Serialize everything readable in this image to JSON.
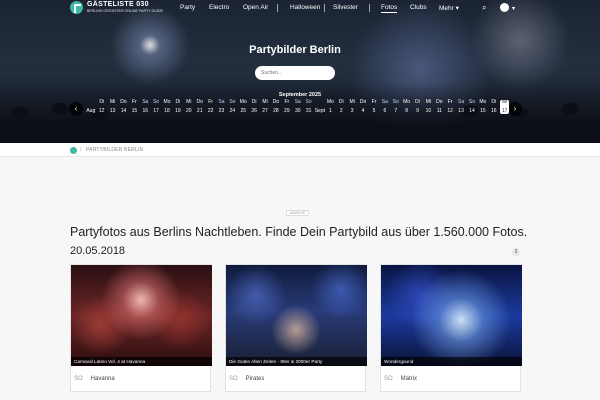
{
  "header": {
    "logo_title": "GÄSTELISTE 030",
    "logo_sub": "BERLINS GRÖSSTER ONLINE PARTY GUIDE",
    "nav": [
      "Party",
      "Electro",
      "Open Air",
      "Halloween",
      "Silvester",
      "Fotos",
      "Clubs",
      "Mehr"
    ],
    "active_nav": "Fotos"
  },
  "hero": {
    "title": "Partybilder Berlin",
    "search_placeholder": "Suchen..."
  },
  "calendar": {
    "month": "September 2025",
    "days": [
      {
        "w": "",
        "d": "Aug"
      },
      {
        "w": "Di",
        "d": "12"
      },
      {
        "w": "Mi",
        "d": "13"
      },
      {
        "w": "Do",
        "d": "14"
      },
      {
        "w": "Fr",
        "d": "15"
      },
      {
        "w": "Sa",
        "d": "16"
      },
      {
        "w": "So",
        "d": "17"
      },
      {
        "w": "Mo",
        "d": "18"
      },
      {
        "w": "Di",
        "d": "19"
      },
      {
        "w": "Mi",
        "d": "20"
      },
      {
        "w": "Do",
        "d": "21"
      },
      {
        "w": "Fr",
        "d": "22"
      },
      {
        "w": "Sa",
        "d": "23"
      },
      {
        "w": "So",
        "d": "24"
      },
      {
        "w": "Mo",
        "d": "25"
      },
      {
        "w": "Di",
        "d": "26"
      },
      {
        "w": "Mi",
        "d": "27"
      },
      {
        "w": "Do",
        "d": "28"
      },
      {
        "w": "Fr",
        "d": "29"
      },
      {
        "w": "Sa",
        "d": "30"
      },
      {
        "w": "So",
        "d": "31"
      },
      {
        "w": "",
        "d": "Sept"
      },
      {
        "w": "Mo",
        "d": "1"
      },
      {
        "w": "Di",
        "d": "2"
      },
      {
        "w": "Mi",
        "d": "3"
      },
      {
        "w": "Do",
        "d": "4"
      },
      {
        "w": "Fr",
        "d": "5"
      },
      {
        "w": "Sa",
        "d": "6"
      },
      {
        "w": "So",
        "d": "7"
      },
      {
        "w": "Mo",
        "d": "8"
      },
      {
        "w": "Di",
        "d": "9"
      },
      {
        "w": "Mi",
        "d": "10"
      },
      {
        "w": "Do",
        "d": "11"
      },
      {
        "w": "Fr",
        "d": "12"
      },
      {
        "w": "Sa",
        "d": "13"
      },
      {
        "w": "So",
        "d": "14"
      },
      {
        "w": "Mo",
        "d": "15"
      },
      {
        "w": "Di",
        "d": "16"
      },
      {
        "w": "Mi",
        "d": "17"
      }
    ],
    "selected_day": "17"
  },
  "breadcrumb": {
    "label": "PARTYBILDER BERLIN"
  },
  "main": {
    "ad_label": "ANZEIGE",
    "headline": "Partyfotos aus Berlins Nachtleben. Finde Dein Partybild aus über 1.560.000 Fotos.",
    "date": "20.05.2018",
    "count": "3",
    "cards": [
      {
        "caption": "Carnaval Latino Vol. 4 at Havanna",
        "day": "SO",
        "venue": "Havanna"
      },
      {
        "caption": "Die Guten Alten Zeiten - 90er & 2000er Party",
        "day": "SO",
        "venue": "Pirates"
      },
      {
        "caption": "Wondergound",
        "day": "SO",
        "venue": "Matrix"
      }
    ]
  },
  "icons": {
    "search": "search-icon",
    "user": "user-icon",
    "prev": "chevron-left-icon",
    "next": "chevron-right-icon"
  },
  "colors": {
    "brand": "#3fb8a6",
    "page_bg": "#f7f7f7"
  }
}
